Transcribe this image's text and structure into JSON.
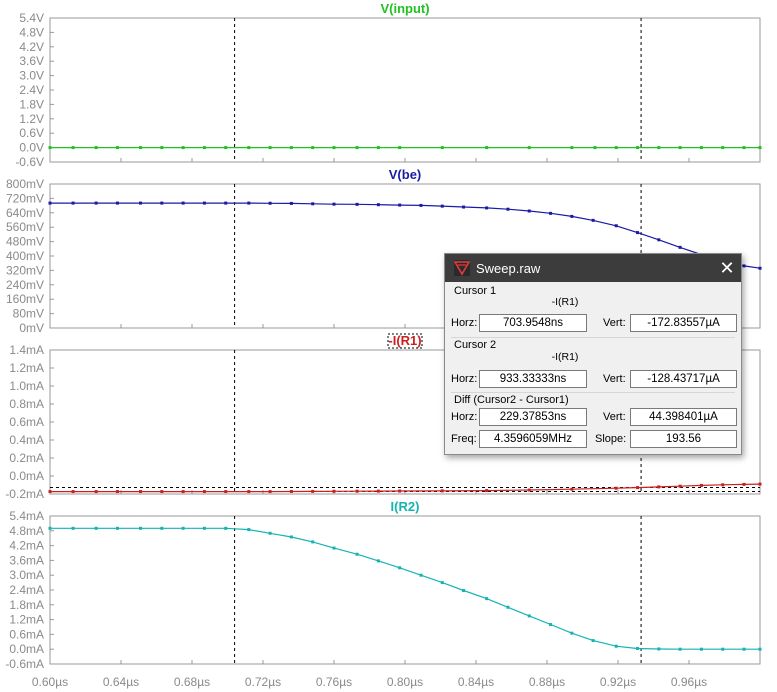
{
  "window": {
    "title": "Sweep.raw",
    "close_glyph": "✕"
  },
  "cursor1": {
    "group": "Cursor 1",
    "trace": "-I(R1)",
    "horz_label": "Horz:",
    "horz": "703.9548ns",
    "vert_label": "Vert:",
    "vert": "-172.83557µA"
  },
  "cursor2": {
    "group": "Cursor 2",
    "trace": "-I(R1)",
    "horz_label": "Horz:",
    "horz": "933.33333ns",
    "vert_label": "Vert:",
    "vert": "-128.43717µA"
  },
  "diff": {
    "group": "Diff (Cursor2 - Cursor1)",
    "horz_label": "Horz:",
    "horz": "229.37853ns",
    "vert_label": "Vert:",
    "vert": "44.398401µA",
    "freq_label": "Freq:",
    "freq": "4.3596059MHz",
    "slope_label": "Slope:",
    "slope": "193.56"
  },
  "colors": {
    "input": "#21c121",
    "vbe": "#1a1aa6",
    "ir1": "#cc1f1f",
    "ir2": "#16b3b3",
    "axis_text": "#8a8a8a"
  },
  "chart_data": {
    "x_axis": {
      "range_us": [
        0.6,
        1.0
      ],
      "tick_values_us": [
        0.6,
        0.64,
        0.68,
        0.72,
        0.76,
        0.8,
        0.84,
        0.88,
        0.92,
        0.96
      ],
      "tick_labels": [
        "0.60µs",
        "0.64µs",
        "0.68µs",
        "0.72µs",
        "0.76µs",
        "0.80µs",
        "0.84µs",
        "0.88µs",
        "0.92µs",
        "0.96µs"
      ]
    },
    "cursors_us": [
      0.704,
      0.933
    ],
    "panes": [
      {
        "id": "input",
        "title": "V(input)",
        "type": "line",
        "unit": "V",
        "ylim": [
          -0.6,
          5.4
        ],
        "ticks": [
          5.4,
          4.8,
          4.2,
          3.6,
          3.0,
          2.4,
          1.8,
          1.2,
          0.6,
          0.0,
          -0.6
        ],
        "tick_labels": [
          "5.4V",
          "4.8V",
          "4.2V",
          "3.6V",
          "3.0V",
          "2.4V",
          "1.8V",
          "1.2V",
          "0.6V",
          "0.0V",
          "-0.6V"
        ],
        "points": [
          [
            0.6,
            0.0
          ],
          [
            0.613,
            0.0
          ],
          [
            0.626,
            0.0
          ],
          [
            0.638,
            0.0
          ],
          [
            0.651,
            0.0
          ],
          [
            0.663,
            0.0
          ],
          [
            0.675,
            0.0
          ],
          [
            0.687,
            0.0
          ],
          [
            0.699,
            0.0
          ],
          [
            0.712,
            0.0
          ],
          [
            0.724,
            0.0
          ],
          [
            0.736,
            0.0
          ],
          [
            0.748,
            0.0
          ],
          [
            0.76,
            0.0
          ],
          [
            0.773,
            0.0
          ],
          [
            0.785,
            0.0
          ],
          [
            0.797,
            0.0
          ],
          [
            0.821,
            0.0
          ],
          [
            0.846,
            0.0
          ],
          [
            0.87,
            0.0
          ],
          [
            0.894,
            0.0
          ],
          [
            0.907,
            0.0
          ],
          [
            0.919,
            0.0
          ],
          [
            0.931,
            0.0
          ],
          [
            0.943,
            0.0
          ],
          [
            0.955,
            0.0
          ],
          [
            0.967,
            0.0
          ],
          [
            0.979,
            0.0
          ],
          [
            0.991,
            0.0
          ],
          [
            1.0,
            0.0
          ]
        ]
      },
      {
        "id": "vbe",
        "title": "V(be)",
        "type": "line",
        "unit": "mV",
        "ylim": [
          0,
          800
        ],
        "ticks": [
          800,
          720,
          640,
          560,
          480,
          400,
          320,
          240,
          160,
          80,
          0
        ],
        "tick_labels": [
          "800mV",
          "720mV",
          "640mV",
          "560mV",
          "480mV",
          "400mV",
          "320mV",
          "240mV",
          "160mV",
          "80mV",
          "0mV"
        ],
        "points": [
          [
            0.6,
            694
          ],
          [
            0.613,
            694
          ],
          [
            0.626,
            694
          ],
          [
            0.638,
            694
          ],
          [
            0.651,
            694
          ],
          [
            0.663,
            694
          ],
          [
            0.675,
            694
          ],
          [
            0.687,
            694
          ],
          [
            0.699,
            694
          ],
          [
            0.712,
            694
          ],
          [
            0.724,
            693
          ],
          [
            0.736,
            692
          ],
          [
            0.748,
            690
          ],
          [
            0.76,
            688
          ],
          [
            0.773,
            687
          ],
          [
            0.785,
            685
          ],
          [
            0.797,
            683
          ],
          [
            0.809,
            681
          ],
          [
            0.821,
            677
          ],
          [
            0.833,
            672
          ],
          [
            0.846,
            667
          ],
          [
            0.858,
            660
          ],
          [
            0.87,
            650
          ],
          [
            0.882,
            637
          ],
          [
            0.894,
            620
          ],
          [
            0.906,
            598
          ],
          [
            0.919,
            568
          ],
          [
            0.931,
            530
          ],
          [
            0.943,
            490
          ],
          [
            0.955,
            448
          ],
          [
            0.967,
            408
          ],
          [
            0.979,
            372
          ],
          [
            0.991,
            345
          ],
          [
            1.0,
            332
          ]
        ]
      },
      {
        "id": "ir1",
        "title": "-I(R1)",
        "type": "line",
        "unit": "mA",
        "ylim": [
          -0.2,
          1.4
        ],
        "ticks": [
          1.4,
          1.2,
          1.0,
          0.8,
          0.6,
          0.4,
          0.2,
          0.0,
          -0.2
        ],
        "tick_labels": [
          "1.4mA",
          "1.2mA",
          "1.0mA",
          "0.8mA",
          "0.6mA",
          "0.4mA",
          "0.2mA",
          "0.0mA",
          "-0.2mA"
        ],
        "points": [
          [
            0.6,
            -0.173
          ],
          [
            0.613,
            -0.173
          ],
          [
            0.626,
            -0.173
          ],
          [
            0.638,
            -0.173
          ],
          [
            0.651,
            -0.173
          ],
          [
            0.663,
            -0.173
          ],
          [
            0.675,
            -0.173
          ],
          [
            0.687,
            -0.173
          ],
          [
            0.699,
            -0.173
          ],
          [
            0.712,
            -0.173
          ],
          [
            0.724,
            -0.173
          ],
          [
            0.736,
            -0.172
          ],
          [
            0.748,
            -0.171
          ],
          [
            0.76,
            -0.17
          ],
          [
            0.773,
            -0.169
          ],
          [
            0.785,
            -0.168
          ],
          [
            0.797,
            -0.167
          ],
          [
            0.821,
            -0.165
          ],
          [
            0.846,
            -0.162
          ],
          [
            0.87,
            -0.156
          ],
          [
            0.894,
            -0.147
          ],
          [
            0.919,
            -0.136
          ],
          [
            0.931,
            -0.129
          ],
          [
            0.943,
            -0.121
          ],
          [
            0.955,
            -0.113
          ],
          [
            0.967,
            -0.105
          ],
          [
            0.979,
            -0.098
          ],
          [
            0.991,
            -0.093
          ],
          [
            1.0,
            -0.09
          ]
        ]
      },
      {
        "id": "ir2",
        "title": "I(R2)",
        "type": "line",
        "unit": "mA",
        "ylim": [
          -0.6,
          5.4
        ],
        "ticks": [
          5.4,
          4.8,
          4.2,
          3.6,
          3.0,
          2.4,
          1.8,
          1.2,
          0.6,
          0.0,
          -0.6
        ],
        "tick_labels": [
          "5.4mA",
          "4.8mA",
          "4.2mA",
          "3.6mA",
          "3.0mA",
          "2.4mA",
          "1.8mA",
          "1.2mA",
          "0.6mA",
          "0.0mA",
          "-0.6mA"
        ],
        "points": [
          [
            0.6,
            4.9
          ],
          [
            0.613,
            4.9
          ],
          [
            0.626,
            4.9
          ],
          [
            0.638,
            4.9
          ],
          [
            0.651,
            4.9
          ],
          [
            0.663,
            4.9
          ],
          [
            0.675,
            4.9
          ],
          [
            0.687,
            4.9
          ],
          [
            0.699,
            4.9
          ],
          [
            0.712,
            4.85
          ],
          [
            0.724,
            4.7
          ],
          [
            0.736,
            4.55
          ],
          [
            0.748,
            4.35
          ],
          [
            0.76,
            4.1
          ],
          [
            0.773,
            3.85
          ],
          [
            0.785,
            3.58
          ],
          [
            0.797,
            3.3
          ],
          [
            0.809,
            3.0
          ],
          [
            0.821,
            2.7
          ],
          [
            0.833,
            2.38
          ],
          [
            0.846,
            2.05
          ],
          [
            0.858,
            1.7
          ],
          [
            0.87,
            1.35
          ],
          [
            0.882,
            1.0
          ],
          [
            0.894,
            0.65
          ],
          [
            0.906,
            0.35
          ],
          [
            0.919,
            0.12
          ],
          [
            0.931,
            0.03
          ],
          [
            0.943,
            0.01
          ],
          [
            0.955,
            0.0
          ],
          [
            0.967,
            0.0
          ],
          [
            0.979,
            0.0
          ],
          [
            0.991,
            0.0
          ],
          [
            1.0,
            0.0
          ]
        ]
      }
    ]
  }
}
